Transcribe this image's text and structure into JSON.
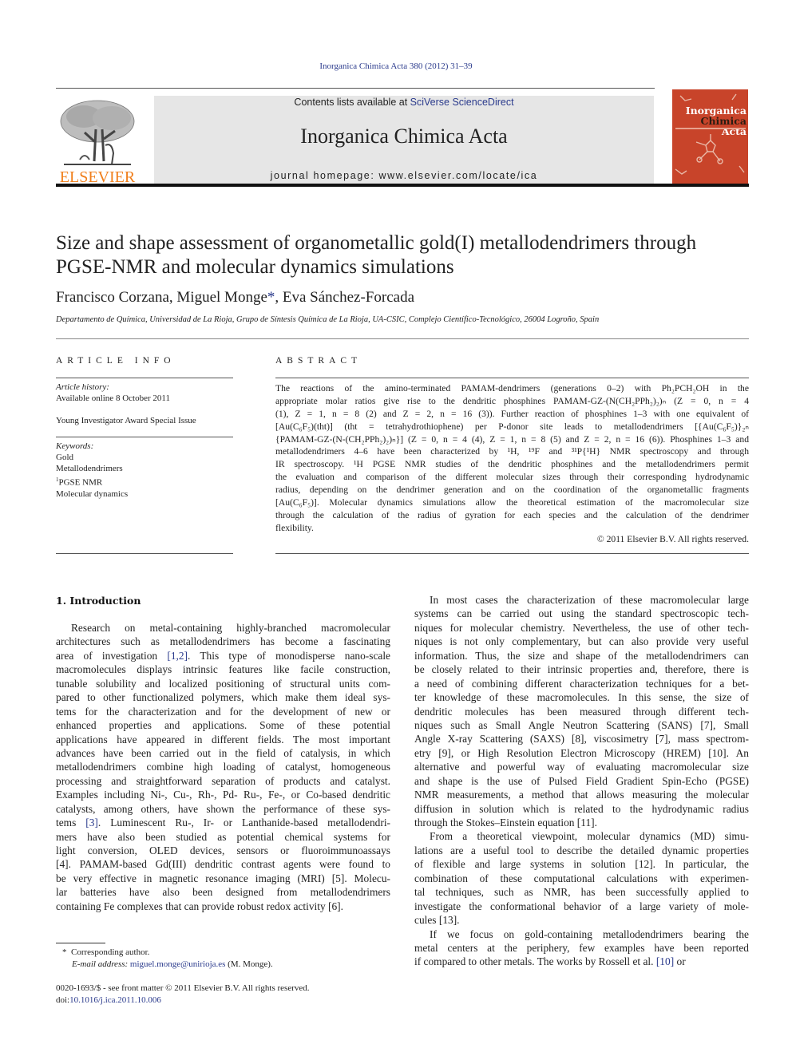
{
  "header": {
    "journal_reference": "Inorganica Chimica Acta 380 (2012) 31–39",
    "contents_prefix": "Contents lists available at ",
    "contents_link": "SciVerse ScienceDirect",
    "journal_name": "Inorganica Chimica Acta",
    "homepage_text": "journal homepage: www.elsevier.com/locate/ica",
    "publisher_logo_text": "ELSEVIER",
    "cover": {
      "title_line1": "Inorganica",
      "title_line2a": "Chimica",
      "title_line2b": "Acta"
    },
    "colors": {
      "link": "#2a3a8c",
      "elsevier_orange": "#f07f1b",
      "cover_red": "#c8442a",
      "masthead_grey": "#e6e6e6"
    }
  },
  "article": {
    "title_line1": "Size and shape assessment of organometallic gold(I) metallodendrimers through",
    "title_line2": "PGSE-NMR and molecular dynamics simulations",
    "authors": {
      "a1": "Francisco Corzana, Miguel Monge",
      "star": "*",
      "a2": ", Eva Sánchez-Forcada"
    },
    "affiliation": "Departamento de Química, Universidad de La Rioja, Grupo de Síntesis Química de La Rioja, UA-CSIC, Complejo Científico-Tecnológico, 26004 Logroño, Spain"
  },
  "article_info": {
    "heading": "ARTICLE INFO",
    "history_label": "Article history:",
    "available_online": "Available online 8 October 2011",
    "special_issue": "Young Investigator Award Special Issue",
    "keywords_label": "Keywords:",
    "keywords": [
      "Gold",
      "Metallodendrimers",
      "PGSE NMR",
      "Molecular dynamics"
    ],
    "keyword_3_sup": "1"
  },
  "abstract": {
    "heading": "ABSTRACT",
    "lines": [
      "The reactions of the amino-terminated PAMAM-dendrimers (generations 0–2) with Ph₂PCH₂OH in the",
      "appropriate molar ratios give rise to the dendritic phosphines PAMAM-GZ-(N(CH₂PPh₂)₂)ₙ (Z = 0, n = 4",
      "(1), Z = 1, n = 8 (2) and Z = 2, n = 16 (3)). Further reaction of phosphines 1–3 with one equivalent of",
      "[Au(C₆F₅)(tht)] (tht = tetrahydrothiophene) per P-donor site leads to metallodendrimers [{Au(C₆F₅)}₂ₙ",
      "{PAMAM-GZ-(N-(CH₂PPh₂)₂)ₙ}] (Z = 0, n = 4 (4), Z = 1, n = 8 (5) and Z = 2, n = 16 (6)). Phosphines 1–3 and",
      "metallodendrimers 4–6 have been characterized by ¹H, ¹⁹F and ³¹P{¹H} NMR spectroscopy and through",
      "IR spectroscopy. ¹H PGSE NMR studies of the dendritic phosphines and the metallodendrimers permit",
      "the evaluation and comparison of the different molecular sizes through their corresponding hydrodynamic",
      "radius, depending on the dendrimer generation and on the coordination of the organometallic fragments",
      "[Au(C₆F₅)]. Molecular dynamics simulations allow the theoretical estimation of the macromolecular size",
      "through the calculation of the radius of gyration for each species and the calculation of the dendrimer",
      "flexibility."
    ],
    "copyright": "© 2011 Elsevier B.V. All rights reserved."
  },
  "introduction": {
    "heading": "1. Introduction",
    "left_column": [
      "Research on metal-containing highly-branched macromolecular",
      "architectures such as metallodendrimers has become a fascinating",
      "area of investigation [1,2]. This type of monodisperse nano-scale",
      "macromolecules displays intrinsic features like facile construction,",
      "tunable solubility and localized positioning of structural units com-",
      "pared to other functionalized polymers, which make them ideal sys-",
      "tems for the characterization and for the development of new or",
      "enhanced properties and applications. Some of these potential",
      "applications have appeared in different fields. The most important",
      "advances have been carried out in the field of catalysis, in which",
      "metallodendrimers combine high loading of catalyst, homogeneous",
      "processing and straightforward separation of products and catalyst.",
      "Examples including Ni-, Cu-, Rh-, Pd- Ru-, Fe-, or Co-based dendritic",
      "catalysts, among others, have shown the performance of these sys-",
      "tems [3]. Luminescent Ru-, Ir- or Lanthanide-based metallodendri-",
      "mers have also been studied as potential chemical systems for",
      "light conversion, OLED devices, sensors or fluoroimmunoassays",
      "[4]. PAMAM-based Gd(III) dendritic contrast agents were found to",
      "be very effective in magnetic resonance imaging (MRI) [5]. Molecu-",
      "lar batteries have also been designed from metallodendrimers",
      "containing Fe complexes that can provide robust redox activity [6]."
    ],
    "right_column": [
      "In most cases the characterization of these macromolecular large",
      "systems can be carried out using the standard spectroscopic tech-",
      "niques for molecular chemistry. Nevertheless, the use of other tech-",
      "niques is not only complementary, but can also provide very useful",
      "information. Thus, the size and shape of the metallodendrimers can",
      "be closely related to their intrinsic properties and, therefore, there is",
      "a need of combining different characterization techniques for a bet-",
      "ter knowledge of these macromolecules. In this sense, the size of",
      "dendritic molecules has been measured through different tech-",
      "niques such as Small Angle Neutron Scattering (SANS) [7], Small",
      "Angle X-ray Scattering (SAXS) [8], viscosimetry [7], mass spectrom-",
      "etry [9], or High Resolution Electron Microscopy (HREM) [10]. An",
      "alternative and powerful way of evaluating macromolecular size",
      "and shape is the use of Pulsed Field Gradient Spin-Echo (PGSE)",
      "NMR measurements, a method that allows measuring the molecular",
      "diffusion in solution which is related to the hydrodynamic radius",
      "through the Stokes–Einstein equation [11].",
      "From a theoretical viewpoint, molecular dynamics (MD) simu-",
      "lations are a useful tool to describe the detailed dynamic properties",
      "of flexible and large systems in solution [12]. In particular, the",
      "combination of these computational calculations with experimen-",
      "tal techniques, such as NMR, has been successfully applied to",
      "investigate the conformational behavior of a large variety of mole-",
      "cules [13].",
      "If we focus on gold-containing metallodendrimers bearing the",
      "metal centers at the periphery, few examples have been reported",
      "if compared to other metals. The works by Rossell et al. [10] or"
    ]
  },
  "footnotes": {
    "star": "*",
    "corresponding": "Corresponding author.",
    "email_label": "E-mail address: ",
    "email": "miguel.monge@unirioja.es",
    "email_suffix": " (M. Monge).",
    "front_matter": "0020-1693/$ - see front matter © 2011 Elsevier B.V. All rights reserved.",
    "doi_label": "doi:",
    "doi": "10.1016/j.ica.2011.10.006"
  }
}
